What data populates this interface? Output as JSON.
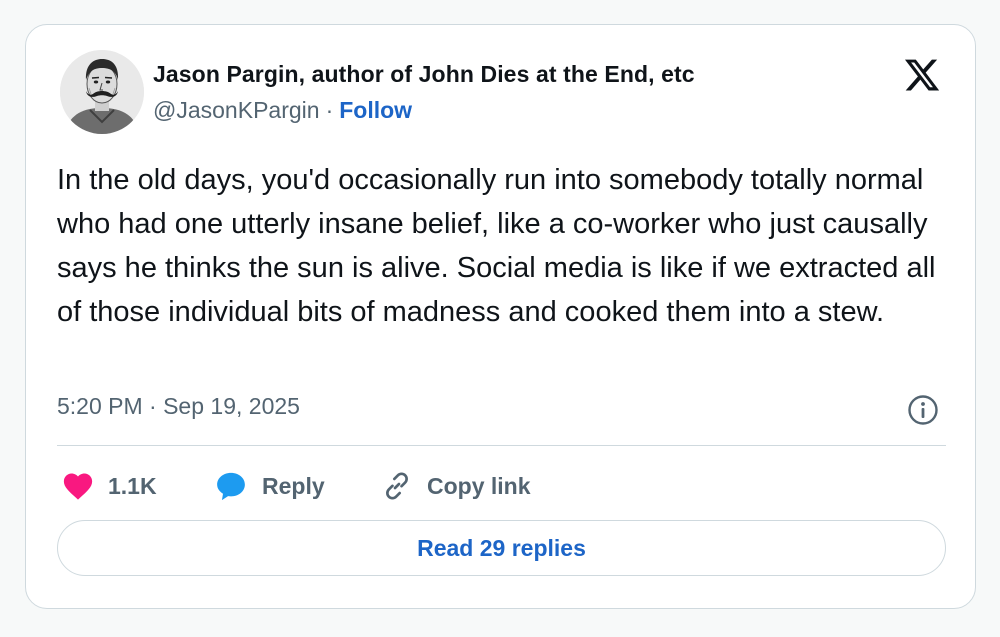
{
  "author": {
    "display_name": "Jason Pargin, author of John Dies at the End, etc",
    "handle": "@JasonKPargin",
    "separator": "·",
    "follow_label": "Follow",
    "avatar_icon": "author-portrait"
  },
  "platform": {
    "logo_icon": "x-logo"
  },
  "tweet": {
    "text": "In the old days, you'd occasionally run into somebody totally normal who had one utterly insane belief, like a co-worker who just causally says he thinks the sun is alive. Social media is like if we extracted all of those individual bits of madness and cooked them into a stew.",
    "timestamp": "5:20 PM · Sep 19, 2025",
    "info_icon": "info-icon"
  },
  "actions": {
    "like_count": "1.1K",
    "reply_label": "Reply",
    "copy_link_label": "Copy link",
    "like_icon": "heart-icon",
    "reply_icon": "speech-bubble-icon",
    "copy_icon": "link-icon"
  },
  "footer": {
    "read_replies_label": "Read 29 replies"
  },
  "colors": {
    "accent": "#1d65c7",
    "like": "#f91880",
    "reply": "#1d9bf0",
    "text_primary": "#0f1419",
    "text_secondary": "#536471",
    "border": "#cfd9de"
  }
}
